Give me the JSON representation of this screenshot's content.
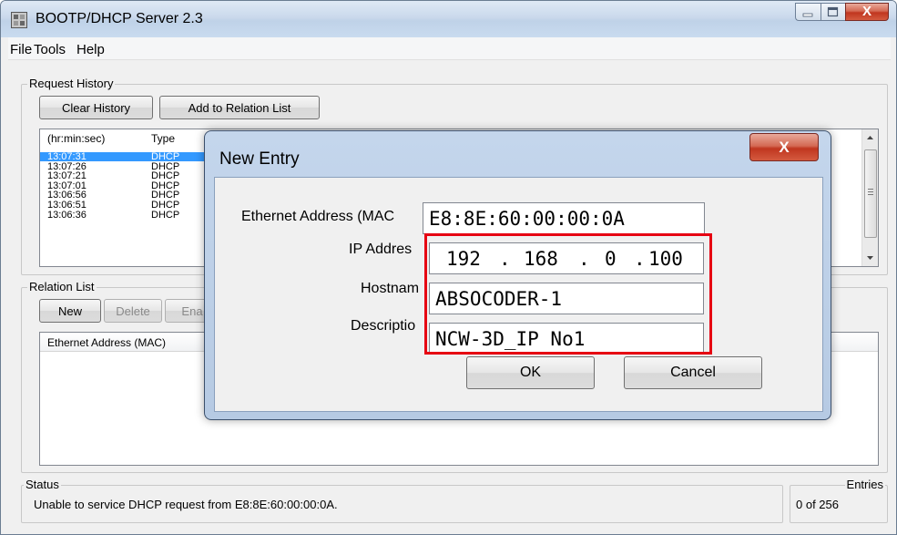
{
  "window": {
    "title": "BOOTP/DHCP Server 2.3",
    "close_symbol": "X"
  },
  "menu": [
    "File",
    "Tools",
    "Help"
  ],
  "request_history": {
    "label": "Request History",
    "clear_button": "Clear History",
    "add_button": "Add to Relation List",
    "columns": [
      "(hr:min:sec)",
      "Type"
    ],
    "rows": [
      {
        "time": "13:07:31",
        "type": "DHCP",
        "selected": true
      },
      {
        "time": "13:07:26",
        "type": "DHCP",
        "selected": false
      },
      {
        "time": "13:07:21",
        "type": "DHCP",
        "selected": false
      },
      {
        "time": "13:07:01",
        "type": "DHCP",
        "selected": false
      },
      {
        "time": "13:06:56",
        "type": "DHCP",
        "selected": false
      },
      {
        "time": "13:06:51",
        "type": "DHCP",
        "selected": false
      },
      {
        "time": "13:06:36",
        "type": "DHCP",
        "selected": false
      }
    ]
  },
  "relation_list": {
    "label": "Relation List",
    "new_button": "New",
    "delete_button": "Delete",
    "enable_button": "Ena",
    "columns": [
      "Ethernet Address (MAC)"
    ]
  },
  "status": {
    "label": "Status",
    "message": "Unable to service DHCP request from E8:8E:60:00:00:0A."
  },
  "entries": {
    "label": "Entries",
    "value": "0 of 256"
  },
  "dialog": {
    "title": "New Entry",
    "close_symbol": "X",
    "mac_label": "Ethernet Address (MAC",
    "mac_value": "E8:8E:60:00:00:0A",
    "ip_label": "IP Addres",
    "ip_octets": [
      "192",
      "168",
      "0",
      "100"
    ],
    "hostname_label": "Hostnam",
    "hostname_value": "ABSOCODER-1",
    "description_label": "Descriptio",
    "description_value": "NCW-3D_IP No1",
    "ok_button": "OK",
    "cancel_button": "Cancel"
  },
  "colors": {
    "selection": "#3399ff",
    "highlight": "#e60012"
  }
}
